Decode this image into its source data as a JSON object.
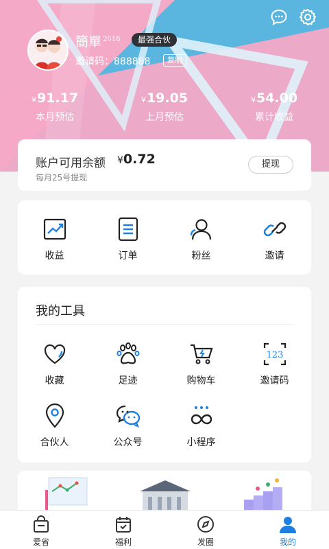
{
  "header": {
    "username": "簡單",
    "username_sup": "2018",
    "badge": "最强合伙",
    "invite_text": "邀请码：888888",
    "copy_label": "复制",
    "currency": "¥",
    "stats": [
      {
        "value": "91.17",
        "label": "本月预估"
      },
      {
        "value": "19.05",
        "label": "上月预估"
      },
      {
        "value": "54.00",
        "label": "累计收益"
      }
    ]
  },
  "balance": {
    "title": "账户可用余额",
    "currency": "¥",
    "amount": "0.72",
    "note": "每月25号提现",
    "withdraw_label": "提现"
  },
  "quick": [
    {
      "label": "收益",
      "icon": "chart-icon"
    },
    {
      "label": "订单",
      "icon": "document-icon"
    },
    {
      "label": "粉丝",
      "icon": "fans-icon"
    },
    {
      "label": "邀请",
      "icon": "link-icon"
    }
  ],
  "tools": {
    "title": "我的工具",
    "items": [
      {
        "label": "收藏",
        "icon": "heart-icon"
      },
      {
        "label": "足迹",
        "icon": "paw-icon"
      },
      {
        "label": "购物车",
        "icon": "cart-icon"
      },
      {
        "label": "邀请码",
        "icon": "code-icon"
      },
      {
        "label": "合伙人",
        "icon": "location-icon"
      },
      {
        "label": "公众号",
        "icon": "wechat-icon"
      },
      {
        "label": "小程序",
        "icon": "miniprogram-icon"
      }
    ],
    "code_text": "123"
  },
  "tabs": [
    {
      "label": "爱省",
      "icon": "bag-icon"
    },
    {
      "label": "福利",
      "icon": "calendar-icon"
    },
    {
      "label": "发圈",
      "icon": "compass-icon"
    },
    {
      "label": "我的",
      "icon": "person-icon"
    }
  ],
  "colors": {
    "accent": "#1e7fe0",
    "header_blue": "#5bb6df",
    "header_pink": "#f4a9c6"
  }
}
